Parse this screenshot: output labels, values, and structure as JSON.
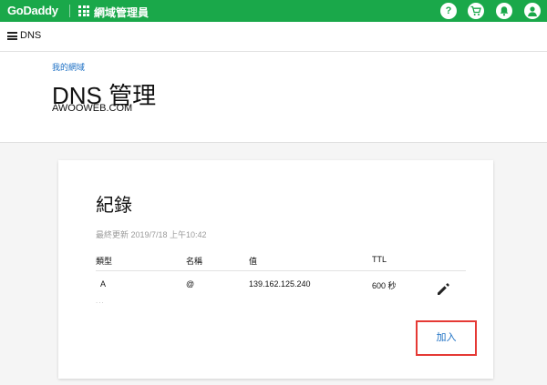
{
  "topbar": {
    "logo": "GoDaddy",
    "app_title": "網域管理員",
    "help_glyph": "?",
    "icons": [
      "grid-icon",
      "help-icon",
      "cart-icon",
      "bell-icon",
      "user-icon"
    ],
    "color": "#1aa84a"
  },
  "subnav": {
    "title": "DNS"
  },
  "header": {
    "breadcrumb": "我的網域",
    "title": "DNS 管理",
    "domain": "AWOOWEB.COM"
  },
  "records": {
    "title": "紀錄",
    "updated": "最終更新 2019/7/18 上午10:42",
    "columns": [
      "類型",
      "名稱",
      "值",
      "TTL"
    ],
    "rows": [
      {
        "type": "A",
        "name": "@",
        "value": "139.162.125.240",
        "ttl": "600 秒"
      }
    ],
    "more": "...",
    "add_label": "加入",
    "highlight_color": "#e53935"
  }
}
